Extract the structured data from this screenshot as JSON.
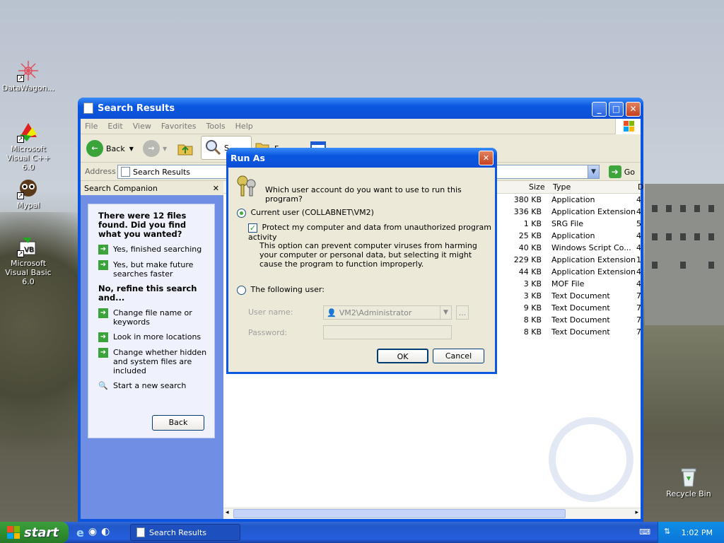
{
  "desktop": {
    "icons": [
      {
        "label": "DataWagon...",
        "icon": "datawagon-icon"
      },
      {
        "label": "Microsoft Visual C++ 6.0",
        "icon": "visual-cpp-icon"
      },
      {
        "label": "Mypal",
        "icon": "mypal-icon"
      },
      {
        "label": "Microsoft Visual Basic 6.0",
        "icon": "visual-basic-icon"
      },
      {
        "label": "Recycle Bin",
        "icon": "recycle-bin-icon"
      }
    ]
  },
  "window": {
    "title": "Search Results",
    "menu": [
      "File",
      "Edit",
      "View",
      "Favorites",
      "Tools",
      "Help"
    ],
    "toolbar": {
      "back_label": "Back",
      "search_label": "S",
      "folders_label": "F"
    },
    "address": {
      "label": "Address",
      "value": "Search Results",
      "go_label": "Go"
    }
  },
  "companion": {
    "title": "Search Companion",
    "close_glyph": "✕",
    "found_text": "There were 12 files found. Did you find what you wanted?",
    "options_yes": [
      "Yes, finished searching",
      "Yes, but make future searches faster"
    ],
    "refine_heading": "No, refine this search and...",
    "options_refine": [
      "Change file name or keywords",
      "Look in more locations",
      "Change whether hidden and system files are included"
    ],
    "new_search": "Start a new search",
    "back_button": "Back"
  },
  "results": {
    "columns": {
      "size": "Size",
      "type": "Type",
      "extra": "D"
    },
    "rows": [
      {
        "size": "380 KB",
        "type": "Application",
        "extra": "4"
      },
      {
        "size": "336 KB",
        "type": "Application Extension",
        "extra": "4"
      },
      {
        "size": "1 KB",
        "type": "SRG File",
        "extra": "5"
      },
      {
        "size": "25 KB",
        "type": "Application",
        "extra": "4"
      },
      {
        "size": "40 KB",
        "type": "Windows Script Co...",
        "extra": "4"
      },
      {
        "size": "229 KB",
        "type": "Application Extension",
        "extra": "1"
      },
      {
        "size": "44 KB",
        "type": "Application Extension",
        "extra": "4"
      },
      {
        "size": "3 KB",
        "type": "MOF File",
        "extra": "4"
      },
      {
        "size": "3 KB",
        "type": "Text Document",
        "extra": "7"
      },
      {
        "size": "9 KB",
        "type": "Text Document",
        "extra": "7"
      },
      {
        "size": "8 KB",
        "type": "Text Document",
        "extra": "7"
      },
      {
        "size": "8 KB",
        "type": "Text Document",
        "extra": "7"
      }
    ]
  },
  "dialog": {
    "title": "Run As",
    "question": "Which user account do you want to use to run this program?",
    "current_user": "Current user (COLLABNET\\VM2)",
    "protect": "Protect my computer and data from unauthorized program activity",
    "note": "This option can prevent computer viruses from harming your computer or personal data, but selecting it might cause the program to function improperly.",
    "following_user": "The following user:",
    "username_label": "User name:",
    "username_value": "VM2\\Administrator",
    "password_label": "Password:",
    "browse_label": "...",
    "ok": "OK",
    "cancel": "Cancel"
  },
  "taskbar": {
    "start": "start",
    "task": "Search Results",
    "clock": "1:02 PM"
  },
  "colors": {
    "xp_blue": "#0a55e0",
    "start_green": "#3c9f3c",
    "tray_blue": "#0f8ee6"
  }
}
